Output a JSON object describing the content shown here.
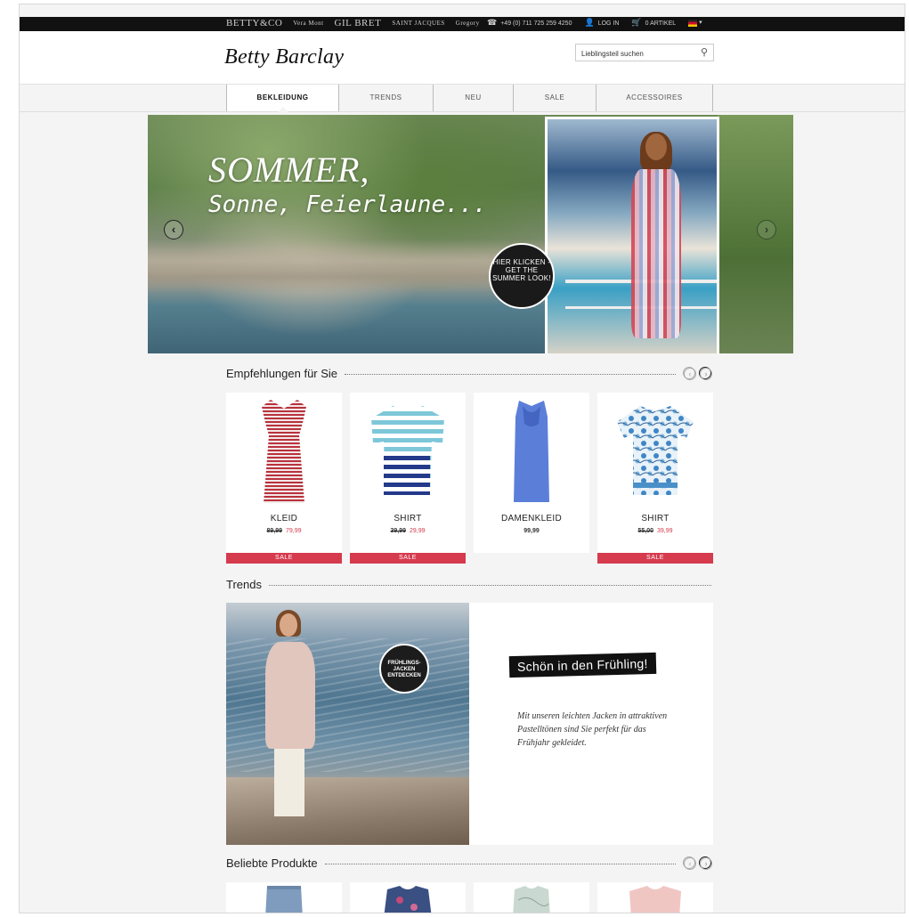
{
  "topbar": {
    "brands": [
      "BETTY&CO",
      "Vera Mont",
      "GIL BRET",
      "SAINT JACQUES",
      "Gregory"
    ],
    "phone": "+49 (0) 711 725 259 4250",
    "login": "LOG IN",
    "cart": "0 ARTIKEL"
  },
  "header": {
    "logo": "Betty Barclay",
    "search_placeholder": "Lieblingsteil suchen"
  },
  "nav": {
    "items": [
      "BEKLEIDUNG",
      "TRENDS",
      "NEU",
      "SALE",
      "ACCESSOIRES"
    ]
  },
  "hero": {
    "headline": "SOMMER,",
    "subline": "Sonne, Feierlaune...",
    "badge": "HIER KLICKEN - GET THE SUMMER LOOK!"
  },
  "recommendations": {
    "title": "Empfehlungen für Sie",
    "products": [
      {
        "name": "KLEID",
        "old_price": "89,99",
        "price": "79,99",
        "sale": "SALE"
      },
      {
        "name": "SHIRT",
        "old_price": "39,99",
        "price": "29,99",
        "sale": "SALE"
      },
      {
        "name": "DAMENKLEID",
        "price": "99,99"
      },
      {
        "name": "SHIRT",
        "old_price": "55,00",
        "price": "39,99",
        "sale": "SALE"
      }
    ]
  },
  "trends": {
    "title": "Trends",
    "badge": "FRÜHLINGS-JACKEN ENTDECKEN",
    "label": "Schön in den Frühling!",
    "copy": "Mit unseren leichten Jacken in attraktiven Pastelltönen sind Sie perfekt für das Frühjahr gekleidet."
  },
  "popular": {
    "title": "Beliebte Produkte"
  },
  "colors": {
    "sale": "#d63a4d",
    "sale_price": "#d23b4a"
  }
}
